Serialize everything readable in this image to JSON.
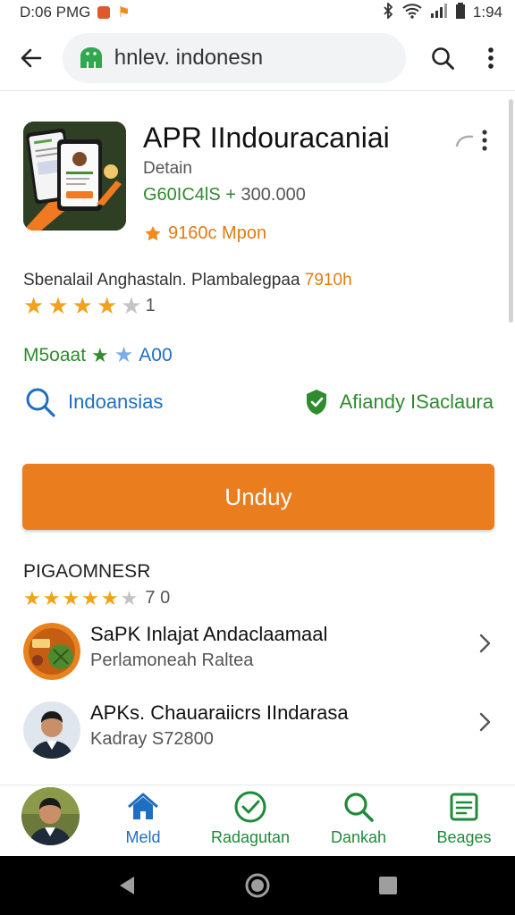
{
  "status_bar": {
    "time_left": "D:06 PMG",
    "time_right": "1:94"
  },
  "browser": {
    "url": "hnlev. indonesn"
  },
  "app": {
    "title": "APR IIndouracaniai",
    "developer": "Detain",
    "downloads_label": "G60IC4lS +",
    "downloads_value": "300.000",
    "badge": "9160c Mpon"
  },
  "description": {
    "text": "Sbenalail Anghastaln. Plambalegpaa",
    "highlight": "7910h"
  },
  "rating": {
    "stars": 4,
    "out_of": 5,
    "count": "1"
  },
  "meta": {
    "left": "M5oaat",
    "right": "A00"
  },
  "links": {
    "search_label": "Indoansias",
    "verified_label": "Afiandy ISaclaura"
  },
  "download_button": "Unduy",
  "section": {
    "title": "PIGAOMNESR",
    "stars": 5,
    "out_of": 6,
    "count": "7 0"
  },
  "list": [
    {
      "title": "SaPK Inlajat Andaclaamaal",
      "subtitle": "Perlamoneah Raltea"
    },
    {
      "title": "APKs. Chauaraiicrs IIndarasa",
      "subtitle": "Kadray S72800"
    }
  ],
  "bottom_nav": [
    {
      "label": "Meld",
      "icon": "home-icon"
    },
    {
      "label": "Radagutan",
      "icon": "check-circle-icon"
    },
    {
      "label": "Dankah",
      "icon": "search-icon"
    },
    {
      "label": "Beages",
      "icon": "document-icon"
    }
  ],
  "colors": {
    "accent_orange": "#ea7d1e",
    "green": "#2e8b2e",
    "blue": "#1e6fc1",
    "star": "#f0a21c"
  }
}
